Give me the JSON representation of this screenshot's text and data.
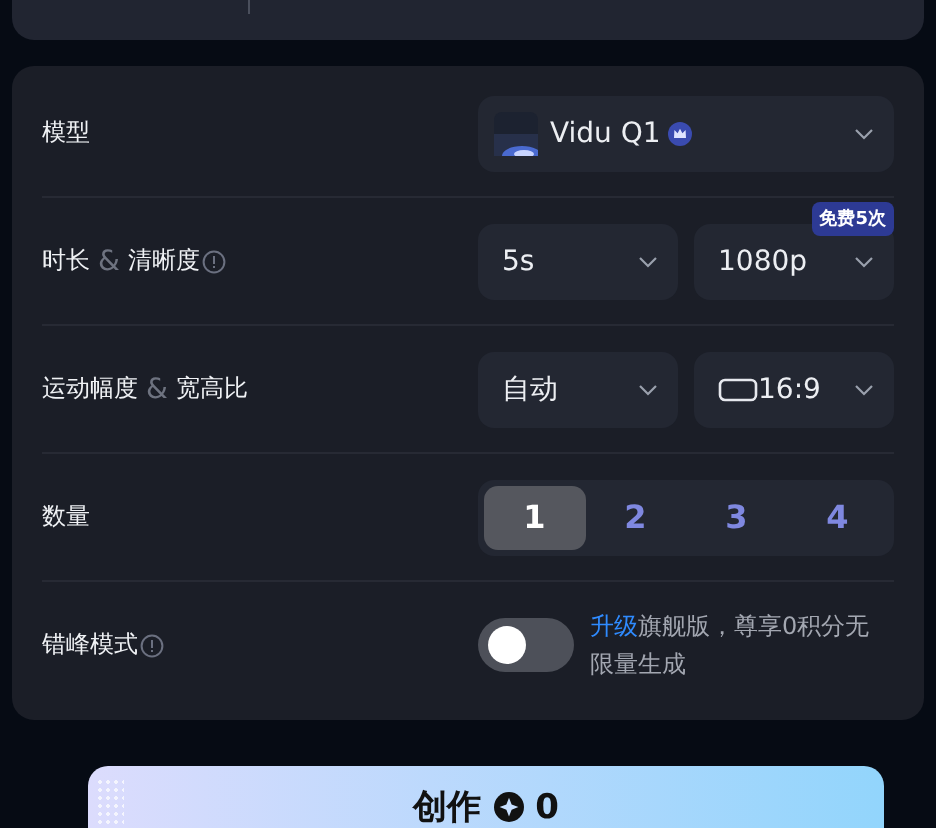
{
  "settings": [
    {
      "kind": "model",
      "label": [
        {
          "text": "模型",
          "kind": "text"
        }
      ],
      "info": false,
      "value": "Vidu Q1",
      "premium": true
    },
    {
      "kind": "selects",
      "label": [
        {
          "text": "时长",
          "kind": "text"
        },
        {
          "text": "&",
          "kind": "separator"
        },
        {
          "text": "清晰度",
          "kind": "text"
        }
      ],
      "info": true,
      "selects": [
        {
          "value": "5s",
          "ratio_icon": false
        },
        {
          "value": "1080p",
          "ratio_icon": false,
          "badge": "免费5次"
        }
      ]
    },
    {
      "kind": "selects",
      "label": [
        {
          "text": "运动幅度",
          "kind": "text"
        },
        {
          "text": "&",
          "kind": "separator"
        },
        {
          "text": "宽高比",
          "kind": "text"
        }
      ],
      "info": false,
      "selects": [
        {
          "value": "自动",
          "ratio_icon": false
        },
        {
          "value": "16:9",
          "ratio_icon": true
        }
      ]
    },
    {
      "kind": "count",
      "label": [
        {
          "text": "数量",
          "kind": "text"
        }
      ],
      "info": false,
      "options": [
        {
          "label": "1",
          "selected": true
        },
        {
          "label": "2",
          "selected": false
        },
        {
          "label": "3",
          "selected": false
        },
        {
          "label": "4",
          "selected": false
        }
      ]
    },
    {
      "kind": "toggle",
      "label": [
        {
          "text": "错峰模式",
          "kind": "text"
        }
      ],
      "info": true,
      "on": false,
      "link": "升级",
      "note": "旗舰版，尊享0积分无限量生成"
    }
  ],
  "create_button": {
    "label": "创作",
    "cost": "0"
  }
}
